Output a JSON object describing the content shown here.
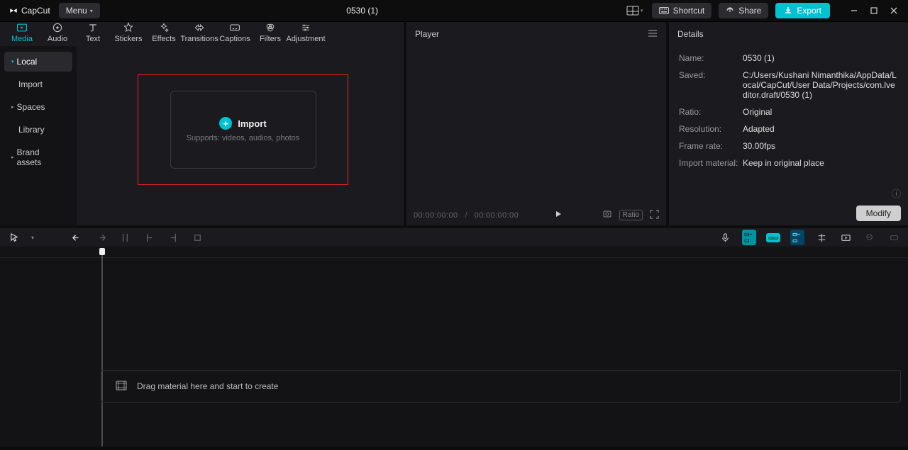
{
  "titlebar": {
    "app_name": "CapCut",
    "menu_label": "Menu",
    "project_title": "0530 (1)",
    "shortcut_label": "Shortcut",
    "share_label": "Share",
    "export_label": "Export"
  },
  "tabs": [
    {
      "id": "media",
      "label": "Media"
    },
    {
      "id": "audio",
      "label": "Audio"
    },
    {
      "id": "text",
      "label": "Text"
    },
    {
      "id": "stickers",
      "label": "Stickers"
    },
    {
      "id": "effects",
      "label": "Effects"
    },
    {
      "id": "transitions",
      "label": "Transitions"
    },
    {
      "id": "captions",
      "label": "Captions"
    },
    {
      "id": "filters",
      "label": "Filters"
    },
    {
      "id": "adjustment",
      "label": "Adjustment"
    }
  ],
  "player": {
    "title": "Player",
    "time_current": "00:00:00:00",
    "time_total": "00:00:00:00",
    "time_sep": "/",
    "ratio_label": "Ratio"
  },
  "details": {
    "title": "Details",
    "rows": {
      "name_label": "Name:",
      "name_value": "0530 (1)",
      "saved_label": "Saved:",
      "saved_value": "C:/Users/Kushani Nimanthika/AppData/Local/CapCut/User Data/Projects/com.lveditor.draft/0530 (1)",
      "ratio_label": "Ratio:",
      "ratio_value": "Original",
      "resolution_label": "Resolution:",
      "resolution_value": "Adapted",
      "framerate_label": "Frame rate:",
      "framerate_value": "30.00fps",
      "import_label": "Import material:",
      "import_value": "Keep in original place"
    },
    "modify_label": "Modify"
  },
  "media": {
    "sidebar": [
      {
        "id": "local",
        "label": "Local",
        "tri": "cyan",
        "selected": true
      },
      {
        "id": "import",
        "label": "Import",
        "indent": true
      },
      {
        "id": "spaces",
        "label": "Spaces",
        "tri": "gray"
      },
      {
        "id": "library",
        "label": "Library",
        "indent": true
      },
      {
        "id": "brand",
        "label": "Brand assets",
        "tri": "gray"
      }
    ],
    "import_label": "Import",
    "import_sub": "Supports: videos, audios, photos"
  },
  "timeline": {
    "drop_hint": "Drag material here and start to create"
  }
}
